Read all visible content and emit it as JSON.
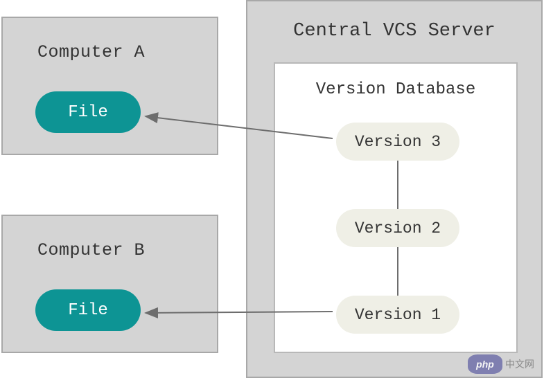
{
  "computerA": {
    "label": "Computer A",
    "file_label": "File"
  },
  "computerB": {
    "label": "Computer B",
    "file_label": "File"
  },
  "server": {
    "title": "Central VCS Server",
    "database_title": "Version Database",
    "versions": {
      "v3": "Version 3",
      "v2": "Version 2",
      "v1": "Version 1"
    }
  },
  "watermark": {
    "logo": "php",
    "text": "中文网"
  },
  "colors": {
    "box_bg": "#d4d4d4",
    "box_border": "#a8a8a8",
    "file_pill": "#0d9494",
    "version_pill": "#efefe6",
    "arrow": "#6d6d6d"
  }
}
